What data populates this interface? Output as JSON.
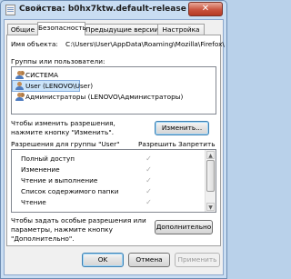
{
  "window": {
    "title": "Свойства: b0hx7ktw.default-release",
    "close_glyph": "✕"
  },
  "tabs": [
    {
      "label": "Общие"
    },
    {
      "label": "Безопасность"
    },
    {
      "label": "Предыдущие версии"
    },
    {
      "label": "Настройка"
    }
  ],
  "security": {
    "object_label": "Имя объекта:",
    "object_path": "C:\\Users\\User\\AppData\\Roaming\\Mozilla\\Firefox\\",
    "groups_label": "Группы или пользователи:",
    "groups": [
      {
        "name": "СИСТЕМА",
        "icon": "group-icon"
      },
      {
        "name": "User (LENOVO\\User)",
        "icon": "user-icon"
      },
      {
        "name": "Администраторы (LENOVO\\Администраторы)",
        "icon": "group-icon"
      }
    ],
    "change_hint": "Чтобы изменить разрешения,\nнажмите кнопку \"Изменить\".",
    "change_button": "Изменить...",
    "perms_label": "Разрешения для группы \"User\"",
    "allow_header": "Разрешить",
    "deny_header": "Запретить",
    "permissions": [
      {
        "name": "Полный доступ",
        "allow": "✓"
      },
      {
        "name": "Изменение",
        "allow": "✓"
      },
      {
        "name": "Чтение и выполнение",
        "allow": "✓"
      },
      {
        "name": "Список содержимого папки",
        "allow": "✓"
      },
      {
        "name": "Чтение",
        "allow": "✓"
      }
    ],
    "advanced_hint": "Чтобы задать особые разрешения или\nпараметры, нажмите кнопку\n\"Дополнительно\".",
    "advanced_button": "Дополнительно"
  },
  "footer": {
    "ok": "OK",
    "cancel": "Отмена",
    "apply": "Применить"
  },
  "colors": {
    "title_bar": "#c9ddf2",
    "close_button": "#c9533e",
    "selection": "#cbe4fa"
  }
}
